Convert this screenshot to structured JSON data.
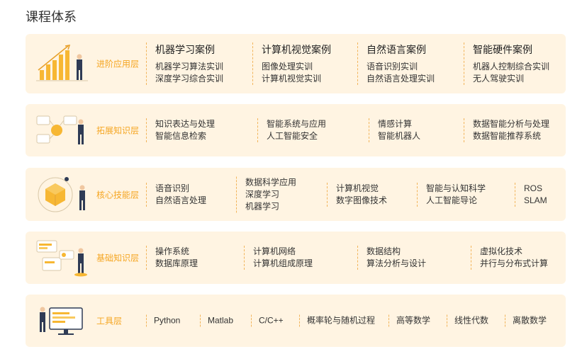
{
  "title": "课程体系",
  "colors": {
    "panel_bg": "#fff4e2",
    "label": "#f5a623",
    "divider": "#f2b45a"
  },
  "layers": [
    {
      "label": "进阶应用层",
      "icon": "bar-chart-person-illustration",
      "columns": [
        {
          "head": "机器学习案例",
          "items": [
            "机器学习算法实训",
            "深度学习综合实训"
          ]
        },
        {
          "head": "计算机视觉案例",
          "items": [
            "图像处理实训",
            "计算机视觉实训"
          ]
        },
        {
          "head": "自然语言案例",
          "items": [
            "语音识别实训",
            "自然语言处理实训"
          ]
        },
        {
          "head": "智能硬件案例",
          "items": [
            "机器人控制综合实训",
            "无人驾驶实训"
          ]
        }
      ]
    },
    {
      "label": "拓展知识层",
      "icon": "network-person-illustration",
      "columns": [
        {
          "items": [
            "知识表达与处理",
            "智能信息检索"
          ]
        },
        {
          "items": [
            "智能系统与应用",
            "人工智能安全"
          ]
        },
        {
          "items": [
            "情感计算",
            "智能机器人"
          ]
        },
        {
          "items": [
            "数据智能分析与处理",
            "数据智能推荐系统"
          ]
        }
      ]
    },
    {
      "label": "核心技能层",
      "icon": "cube-person-illustration",
      "columns": [
        {
          "items": [
            "语音识别",
            "自然语言处理"
          ]
        },
        {
          "items": [
            "数据科学应用",
            "深度学习",
            "机器学习"
          ]
        },
        {
          "items": [
            "计算机视觉",
            "数字图像技术"
          ]
        },
        {
          "items": [
            "智能与认知科学",
            "人工智能导论"
          ]
        },
        {
          "items": [
            "ROS",
            "SLAM"
          ]
        }
      ]
    },
    {
      "label": "基础知识层",
      "icon": "dashboard-person-illustration",
      "columns": [
        {
          "items": [
            "操作系统",
            "数据库原理"
          ]
        },
        {
          "items": [
            "计算机网络",
            "计算机组成原理"
          ]
        },
        {
          "items": [
            "数据结构",
            "算法分析与设计"
          ]
        },
        {
          "items": [
            "虚拟化技术",
            "并行与分布式计算"
          ]
        }
      ]
    },
    {
      "label": "工具层",
      "icon": "monitor-person-illustration",
      "columns": [
        {
          "items": [
            "Python"
          ]
        },
        {
          "items": [
            "Matlab"
          ]
        },
        {
          "items": [
            "C/C++"
          ]
        },
        {
          "items": [
            "概率轮与随机过程"
          ]
        },
        {
          "items": [
            "高等数学"
          ]
        },
        {
          "items": [
            "线性代数"
          ]
        },
        {
          "items": [
            "离散数学"
          ]
        }
      ]
    }
  ]
}
